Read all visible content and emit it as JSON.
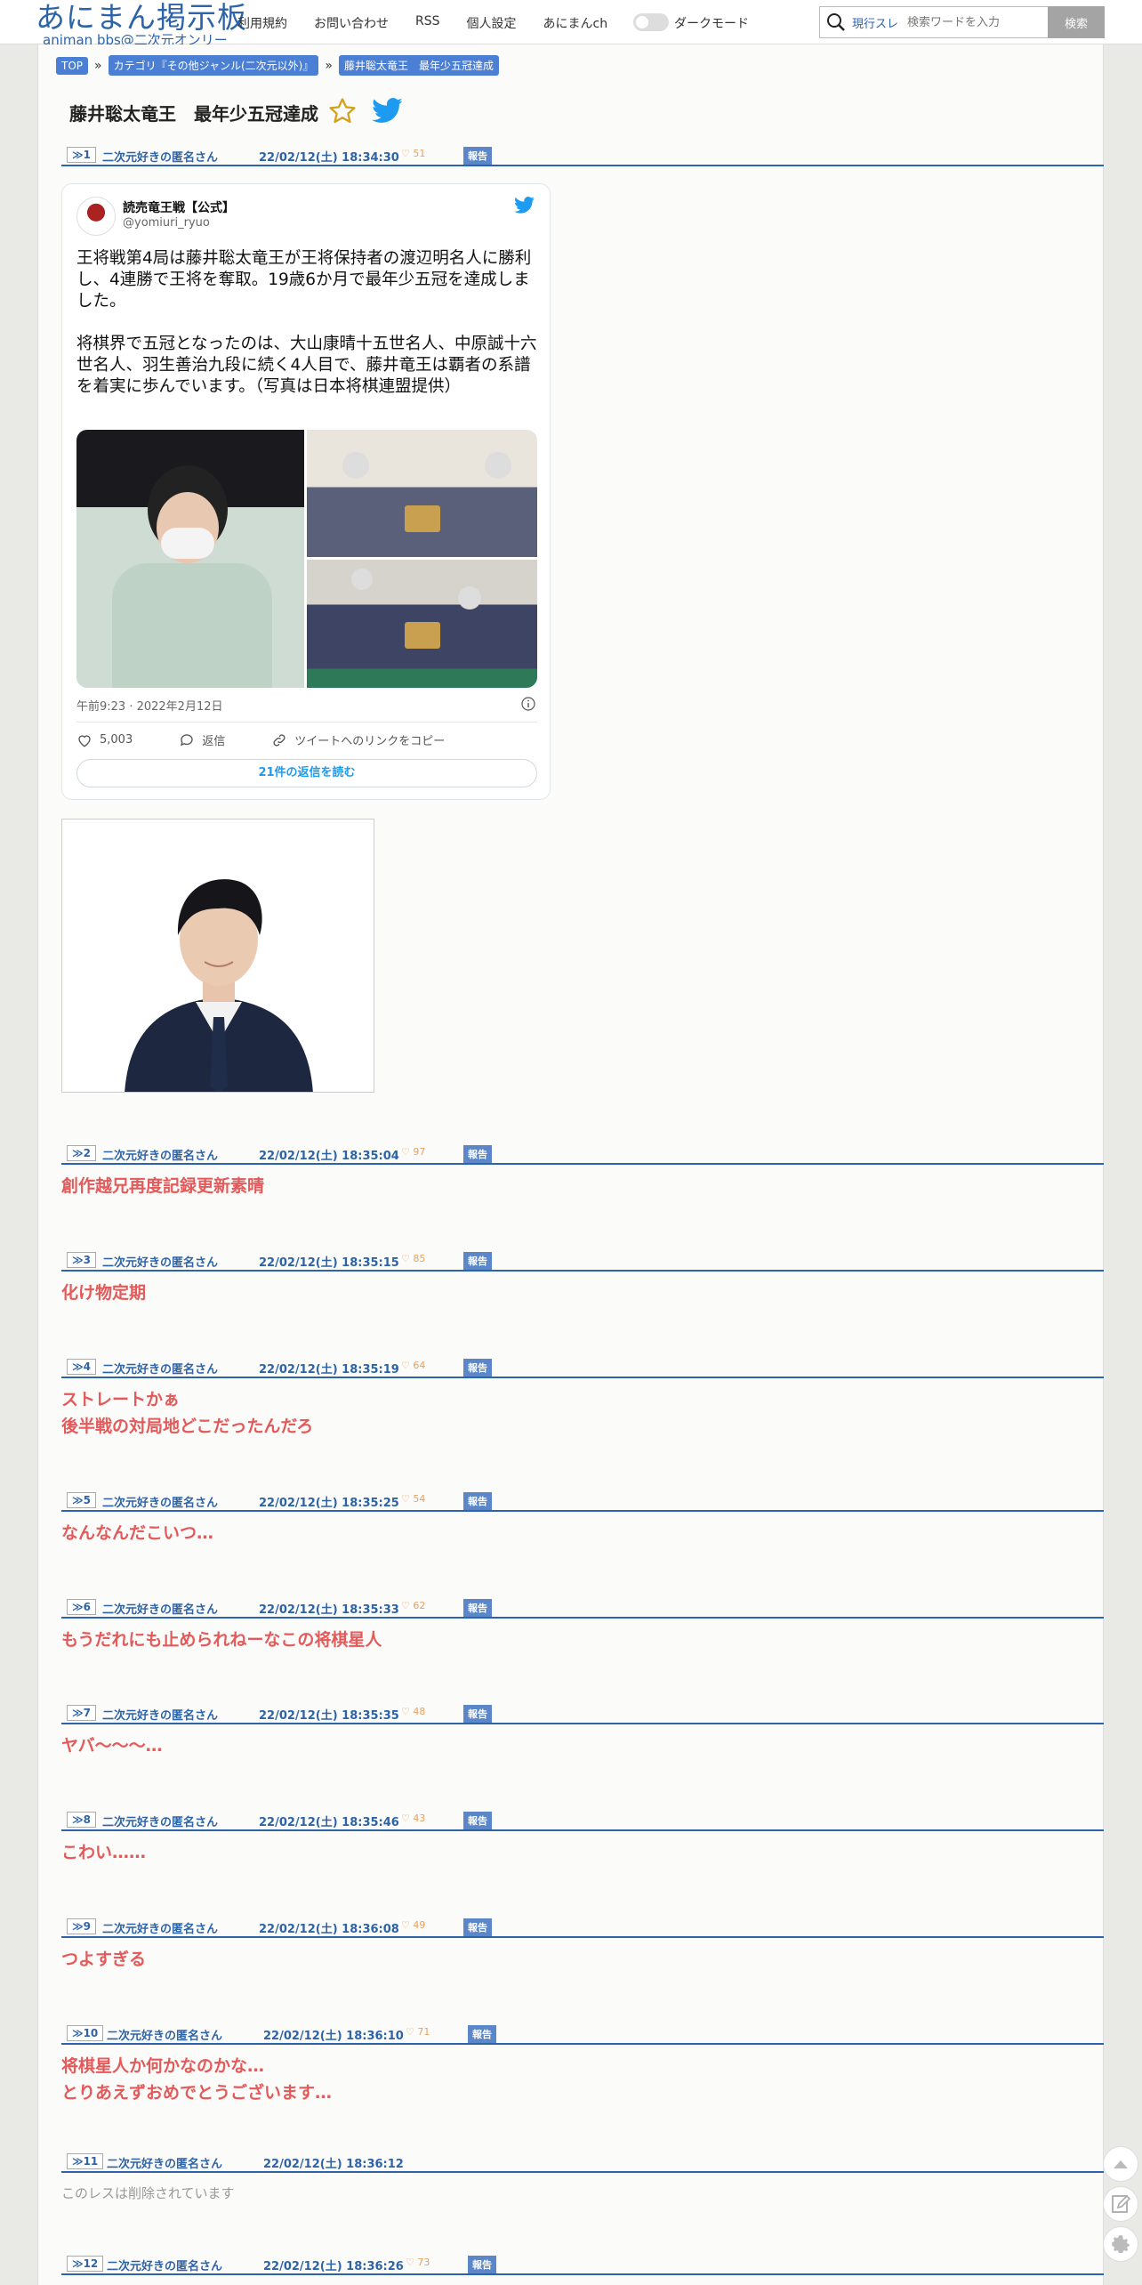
{
  "header": {
    "logo_main": "あにまん掲示板",
    "logo_sub": "animan bbs@二次元オンリー",
    "nav": [
      "利用規約",
      "お問い合わせ",
      "RSS",
      "個人設定",
      "あにまんch"
    ],
    "dark_mode_label": "ダークモード",
    "search_scope": "現行スレ",
    "search_placeholder": "検索ワードを入力",
    "search_button": "検索"
  },
  "breadcrumb": [
    "TOP",
    "カテゴリ『その他ジャンル(二次元以外)』",
    "藤井聡太竜王　最年少五冠達成"
  ],
  "breadcrumb_sep": "»",
  "thread_title": "藤井聡太竜王　最年少五冠達成",
  "report_label": "報告",
  "tweet": {
    "name": "読売竜王戦【公式】",
    "handle": "@yomiuri_ryuo",
    "paragraphs": [
      "王将戦第4局は藤井聡太竜王が王将保持者の渡辺明名人に勝利し、4連勝で王将を奪取。19歳6か月で最年少五冠を達成しました。",
      "将棋界で五冠となったのは、大山康晴十五世名人、中原誠十六世名人、羽生善治九段に続く4人目で、藤井竜王は覇者の系譜を着実に歩んでいます。（写真は日本将棋連盟提供）"
    ],
    "timestamp": "午前9:23 · 2022年2月12日",
    "likes": "5,003",
    "reply_label": "返信",
    "copy_link_label": "ツイートへのリンクをコピー",
    "read_replies": "21件の返信を読む"
  },
  "posts": [
    {
      "num": "≫1",
      "author": "二次元好きの匿名さん",
      "date": "22/02/12(土) 18:34:30",
      "likes": "51",
      "lines": []
    },
    {
      "num": "≫2",
      "author": "二次元好きの匿名さん",
      "date": "22/02/12(土) 18:35:04",
      "likes": "97",
      "lines": [
        "創作越兄再度記録更新素晴"
      ]
    },
    {
      "num": "≫3",
      "author": "二次元好きの匿名さん",
      "date": "22/02/12(土) 18:35:15",
      "likes": "85",
      "lines": [
        "化け物定期"
      ]
    },
    {
      "num": "≫4",
      "author": "二次元好きの匿名さん",
      "date": "22/02/12(土) 18:35:19",
      "likes": "64",
      "lines": [
        "ストレートかぁ",
        "後半戦の対局地どこだったんだろ"
      ]
    },
    {
      "num": "≫5",
      "author": "二次元好きの匿名さん",
      "date": "22/02/12(土) 18:35:25",
      "likes": "54",
      "lines": [
        "なんなんだこいつ…"
      ]
    },
    {
      "num": "≫6",
      "author": "二次元好きの匿名さん",
      "date": "22/02/12(土) 18:35:33",
      "likes": "62",
      "lines": [
        "もうだれにも止められねーなこの将棋星人"
      ]
    },
    {
      "num": "≫7",
      "author": "二次元好きの匿名さん",
      "date": "22/02/12(土) 18:35:35",
      "likes": "48",
      "lines": [
        "ヤバ〜〜〜…"
      ]
    },
    {
      "num": "≫8",
      "author": "二次元好きの匿名さん",
      "date": "22/02/12(土) 18:35:46",
      "likes": "43",
      "lines": [
        "こわい……"
      ]
    },
    {
      "num": "≫9",
      "author": "二次元好きの匿名さん",
      "date": "22/02/12(土) 18:36:08",
      "likes": "49",
      "lines": [
        "つよすぎる"
      ]
    },
    {
      "num": "≫10",
      "author": "二次元好きの匿名さん",
      "date": "22/02/12(土) 18:36:10",
      "likes": "71",
      "lines": [
        "将棋星人か何かなのかな…",
        "とりあえずおめでとうございます…"
      ]
    },
    {
      "num": "≫11",
      "author": "二次元好きの匿名さん",
      "date": "22/02/12(土) 18:36:12",
      "likes": "",
      "deleted": "このレスは削除されています",
      "lines": []
    },
    {
      "num": "≫12",
      "author": "二次元好きの匿名さん",
      "date": "22/02/12(土) 18:36:26",
      "likes": "73",
      "lines": []
    }
  ],
  "colors": {
    "accent": "#2d63a8",
    "post_text": "#e45a5a",
    "report": "#5b86c8",
    "likes": "#e8a060"
  }
}
